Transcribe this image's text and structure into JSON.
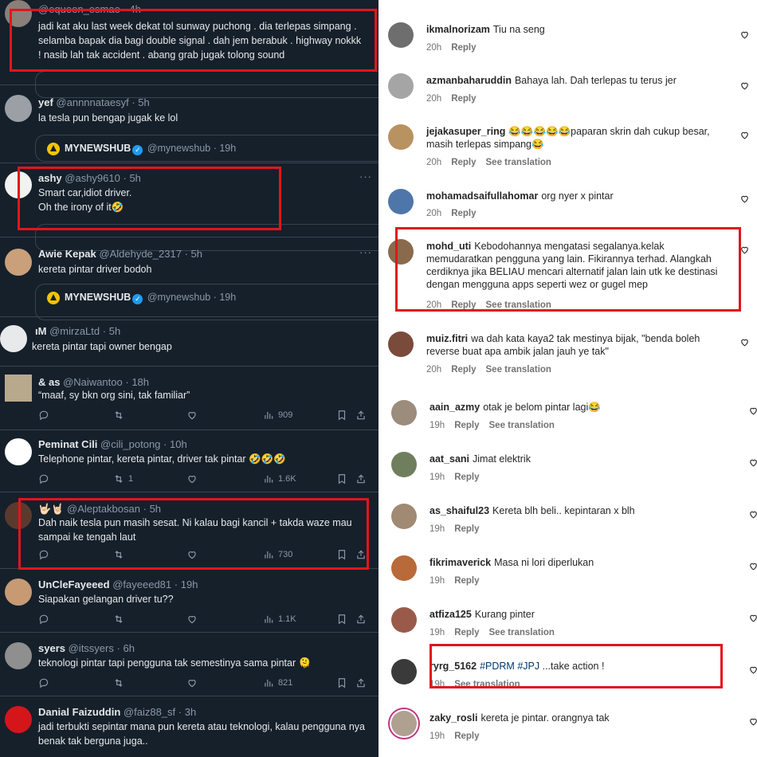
{
  "tweets": [
    {
      "name": "",
      "handle": "@equeen_esmae",
      "time": "4h",
      "text": "jadi kat aku last week dekat tol sunway puchong . dia terlepas simpang . selamba bapak dia bagi double signal . dah jem berabuk . highway nokkk ! nasib lah tak accident . abang grab jugak tolong sound"
    },
    {
      "name": "yef",
      "handle": "@annnnataesyf",
      "time": "5h",
      "text": "la tesla pun bengap jugak ke lol",
      "quote": {
        "name": "MYNEWSHUB",
        "handle": "@mynewshub",
        "time": "19h"
      }
    },
    {
      "name": "ashy",
      "handle": "@ashy9610",
      "time": "5h",
      "line1": "Smart car,idiot driver.",
      "line2": "Oh the irony of it🤣"
    },
    {
      "name": "Awie Kepak",
      "handle": "@Aldehyde_2317",
      "time": "5h",
      "text": "kereta pintar driver bodoh",
      "quote": {
        "name": "MYNEWSHUB",
        "handle": "@mynewshub",
        "time": "19h"
      }
    },
    {
      "name": "ıM",
      "handle": "@mirzaLtd",
      "time": "5h",
      "text": "kereta pintar tapi owner bengap"
    },
    {
      "name": "& as",
      "handle": "@Naiwantoo",
      "time": "18h",
      "text": "“maaf, sy bkn org sini, tak familiar”",
      "views": "909"
    },
    {
      "name": "Peminat Cili",
      "handle": "@cili_potong",
      "time": "10h",
      "text": "Telephone pintar, kereta pintar, driver tak pintar 🤣🤣🤣",
      "retweets": "1",
      "views": "1.6K"
    },
    {
      "name": "🤟🏻🤘🏻",
      "handle": "@Aleptakbosan",
      "time": "5h",
      "text": "Dah naik tesla pun masih sesat. Ni kalau bagi kancil + takda waze mau sampai ke tengah laut",
      "views": "730"
    },
    {
      "name": "UnCleFayeeed",
      "handle": "@fayeeed81",
      "time": "19h",
      "text": "Siapakan gelangan driver tu??",
      "views": "1.1K"
    },
    {
      "name": "syers",
      "handle": "@itssyers",
      "time": "6h",
      "text": "teknologi pintar tapi pengguna tak semestinya sama pintar 🫠",
      "views": "821"
    },
    {
      "name": "Danial Faizuddin",
      "handle": "@faiz88_sf",
      "time": "3h",
      "text": "jadi terbukti sepintar mana pun kereta atau teknologi, kalau pengguna nya benak tak berguna juga.."
    }
  ],
  "comments": [
    {
      "user": "ikmalnorizam",
      "text": "Tiu na seng",
      "time": "20h",
      "reply": "Reply"
    },
    {
      "user": "azmanbaharuddin",
      "text": "Bahaya lah. Dah terlepas tu terus jer",
      "time": "20h",
      "reply": "Reply"
    },
    {
      "user": "jejakasuper_ring",
      "text": "😂😂😂😂😂paparan skrin dah cukup besar, masih terlepas simpang😂",
      "time": "20h",
      "reply": "Reply",
      "translation": "See translation"
    },
    {
      "user": "mohamadsaifullahomar",
      "text": "org nyer x pintar",
      "time": "20h",
      "reply": "Reply"
    },
    {
      "user": "mohd_uti",
      "text": "Kebodohannya mengatasi segalanya.kelak memudaratkan pengguna yang lain. Fikirannya terhad. Alangkah cerdiknya jika BELIAU mencari alternatif jalan lain utk ke destinasi dengan mengguna apps seperti wez or gugel mep",
      "time": "20h",
      "reply": "Reply",
      "translation": "See translation"
    },
    {
      "user": "muiz.fitri",
      "text": "wa dah kata kaya2 tak mestinya bijak, \"benda boleh reverse buat apa ambik jalan jauh ye tak\"",
      "time": "20h",
      "reply": "Reply",
      "translation": "See translation"
    },
    {
      "user": "aain_azmy",
      "text": "otak je belom pintar lagi😂",
      "time": "19h",
      "reply": "Reply",
      "translation": "See translation"
    },
    {
      "user": "aat_sani",
      "text": "Jimat elektrik",
      "time": "19h",
      "reply": "Reply"
    },
    {
      "user": "as_shaiful23",
      "text": "Kereta blh beli.. kepintaran x blh",
      "time": "19h",
      "reply": "Reply"
    },
    {
      "user": "fikrimaverick",
      "text": "Masa ni lori diperlukan",
      "time": "19h",
      "reply": "Reply"
    },
    {
      "user": "atfiza125",
      "text": "Kurang pinter",
      "time": "19h",
      "reply": "Reply",
      "translation": "See translation"
    },
    {
      "user": "ryrg_5162",
      "tags": [
        "#PDRM",
        "#JPJ"
      ],
      "text": "...take action !",
      "time": "19h",
      "translation": "See translation"
    },
    {
      "user": "zaky_rosli",
      "text": "kereta je pintar. orangnya tak",
      "time": "19h",
      "reply": "Reply"
    }
  ],
  "colors": {
    "twitter_bg": "#15202b",
    "twitter_verified": "#1d9bf0",
    "highlight": "#e0161b",
    "instagram_hashtag": "#00376b"
  }
}
